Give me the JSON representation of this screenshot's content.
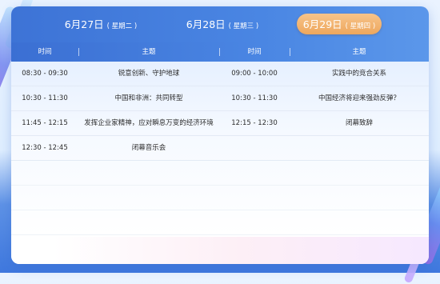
{
  "tabs": [
    {
      "date": "6月27日",
      "weekday": "( 星期二 )",
      "active": false
    },
    {
      "date": "6月28日",
      "weekday": "( 星期三 )",
      "active": false
    },
    {
      "date": "6月29日",
      "weekday": "( 星期四 )",
      "active": true
    }
  ],
  "columns": {
    "time_left": "时间",
    "topic_left": "主题",
    "time_right": "时间",
    "topic_right": "主题"
  },
  "rows": [
    {
      "time_left": "08:30 - 09:30",
      "topic_left": "锐意创新、守护地球",
      "time_right": "09:00 - 10:00",
      "topic_right": "实践中的竞合关系"
    },
    {
      "time_left": "10:30 - 11:30",
      "topic_left": "中国和非洲：共同转型",
      "time_right": "10:30 - 11:30",
      "topic_right": "中国经济将迎来强劲反弹？"
    },
    {
      "time_left": "11:45 - 12:15",
      "topic_left": "发挥企业家精神，应对瞬息万变的经济环境",
      "time_right": "12:15 - 12:30",
      "topic_right": "闭幕致辞"
    },
    {
      "time_left": "12:30 - 12:45",
      "topic_left": "闭幕音乐会",
      "time_right": "",
      "topic_right": ""
    }
  ],
  "colors": {
    "header_blue": "#4a86e3",
    "active_tab_orange": "#eea75d",
    "background_blue": "#3f78de"
  }
}
